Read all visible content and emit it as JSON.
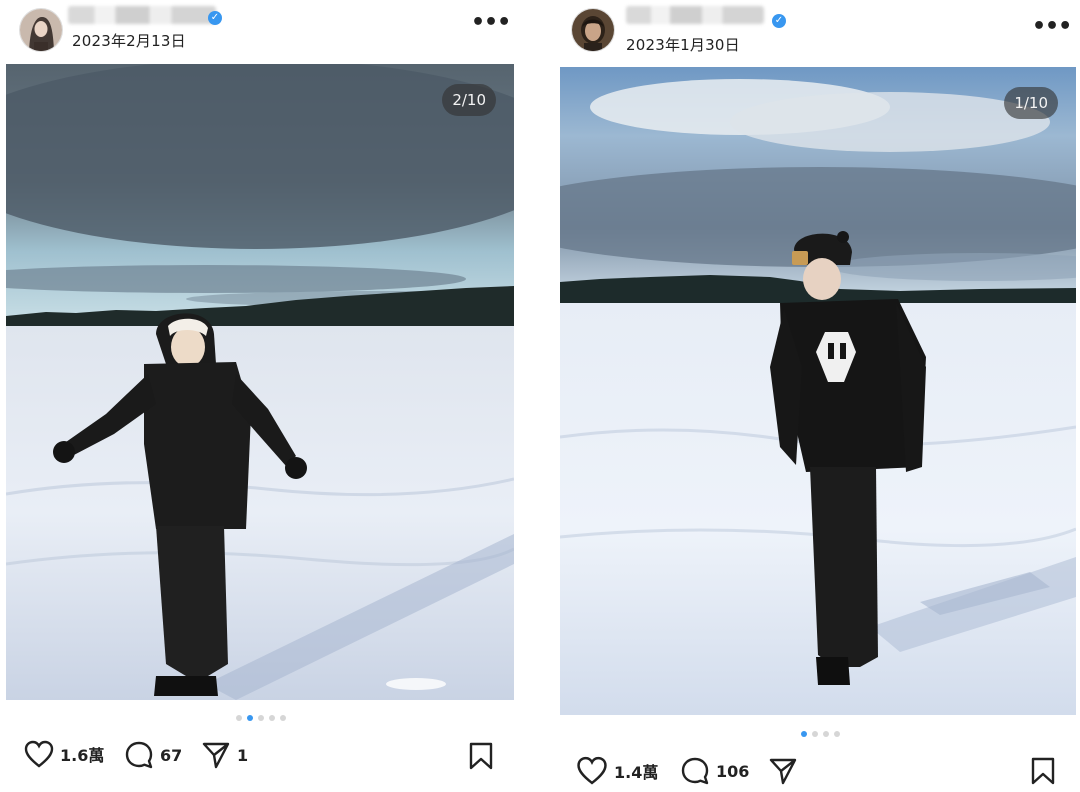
{
  "posts": [
    {
      "date": "2023年2月13日",
      "counter": "2/10",
      "dots_total": 5,
      "dots_active": 1,
      "likes": "1.6萬",
      "comments": "67",
      "shares": "1",
      "more_label": "•••"
    },
    {
      "date": "2023年1月30日",
      "counter": "1/10",
      "dots_total": 4,
      "dots_active": 0,
      "likes": "1.4萬",
      "comments": "106",
      "shares": "",
      "more_label": "•••"
    }
  ],
  "colors": {
    "accent": "#3897f0",
    "snow": "#e8eef6",
    "sky_dark": "#5b6b78",
    "treeline": "#1e2a28"
  },
  "icons": [
    "heart-icon",
    "comment-icon",
    "share-icon",
    "bookmark-icon",
    "verified-icon",
    "more-icon"
  ]
}
